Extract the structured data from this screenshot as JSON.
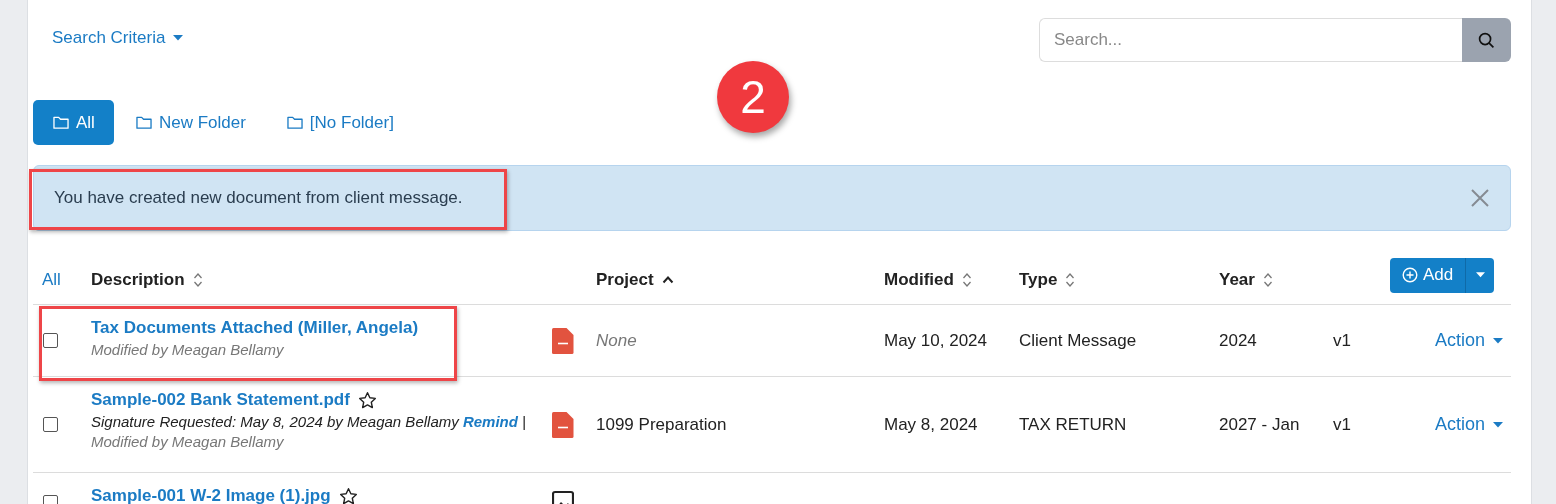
{
  "search_criteria": {
    "label": "Search Criteria"
  },
  "search": {
    "placeholder": "Search..."
  },
  "annotation_badge": "2",
  "folders": [
    {
      "label": "All",
      "selected": true
    },
    {
      "label": "New Folder",
      "selected": false
    },
    {
      "label": "[No Folder]",
      "selected": false
    }
  ],
  "alert": {
    "message": "You have created new document from client message.",
    "highlighted": true
  },
  "table": {
    "select_all": "All",
    "columns": [
      {
        "label": "Description",
        "sorted": false
      },
      {
        "label": "Project",
        "sorted": true
      },
      {
        "label": "Modified",
        "sorted": false
      },
      {
        "label": "Type",
        "sorted": false
      },
      {
        "label": "Year",
        "sorted": false
      }
    ],
    "add_button": "Add",
    "rows": [
      {
        "checked": false,
        "highlighted": true,
        "title": "Tax Documents Attached (Miller, Angela)",
        "has_star": false,
        "modified_by": "Modified by Meagan Bellamy",
        "kind": "pdf",
        "project": "None",
        "project_empty": true,
        "modified": "May 10, 2024",
        "type": "Client Message",
        "year": "2024",
        "version": "v1",
        "action": "Action"
      },
      {
        "checked": false,
        "highlighted": false,
        "title": "Sample-002 Bank Statement.pdf",
        "has_star": true,
        "signature": {
          "text": "Signature Requested: May 8, 2024 by Meagan Bellamy",
          "link": "Remind",
          "rest": "|"
        },
        "modified_by": "Modified by Meagan Bellamy",
        "kind": "pdf",
        "project": "1099 Preparation",
        "project_empty": false,
        "modified": "May 8, 2024",
        "type": "TAX RETURN",
        "year": "2027 - Jan",
        "version": "v1",
        "action": "Action"
      },
      {
        "checked": false,
        "highlighted": false,
        "title": "Sample-001 W-2 Image (1).jpg",
        "has_star": true,
        "kind": "image"
      }
    ]
  }
}
